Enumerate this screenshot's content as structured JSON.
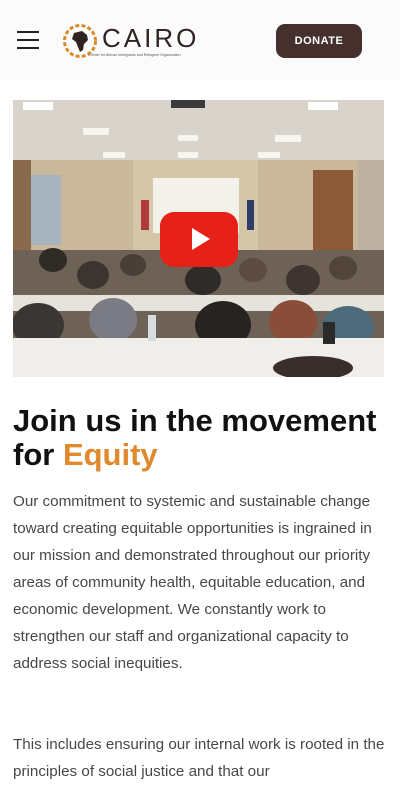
{
  "header": {
    "brand_name": "CAIRO",
    "brand_tagline": "Center for African Immigrants and Refugees Organization",
    "donate_label": "DONATE",
    "menu_icon": "hamburger-menu-icon",
    "donate_color": "#45302e"
  },
  "video": {
    "play_icon": "play-icon",
    "play_color": "#e62117"
  },
  "main": {
    "heading_prefix": "Join us in the movement for ",
    "heading_accent": "Equity",
    "accent_color": "#e08a2b",
    "paragraph1": "Our commitment to systemic and sustainable change toward creating equitable opportunities is ingrained in our mission and demonstrated throughout our priority areas of community health, equitable education, and economic development. We constantly work to strengthen our staff and organizational capacity to address social inequities.",
    "paragraph2": "This includes ensuring our internal work is rooted in the principles of social justice and that our"
  }
}
